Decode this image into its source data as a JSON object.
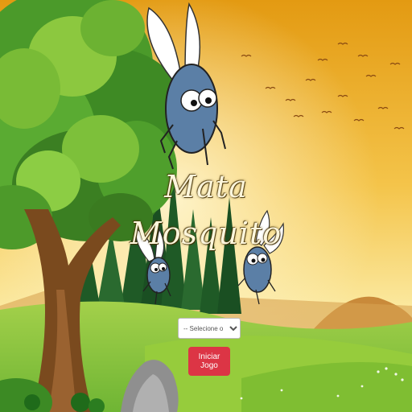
{
  "game": {
    "title_line1": "Mata",
    "title_line2": "Mosquito",
    "level_select": {
      "placeholder": "-- Selecione o Nível --",
      "options": [
        "-- Selecione o Nível --"
      ]
    },
    "start_button_label": "Iniciar Jogo"
  },
  "colors": {
    "sky_top": "#e7a21a",
    "sky_bottom": "#fbe9a0",
    "grass": "#8cc63f",
    "start_button": "#dc3545",
    "mosquito_body": "#5b7fa6"
  },
  "icons": [
    "tree-illustration",
    "mosquito-icon",
    "rock-icon",
    "bird-flock-icon",
    "mountain-icon",
    "bush-icon"
  ]
}
